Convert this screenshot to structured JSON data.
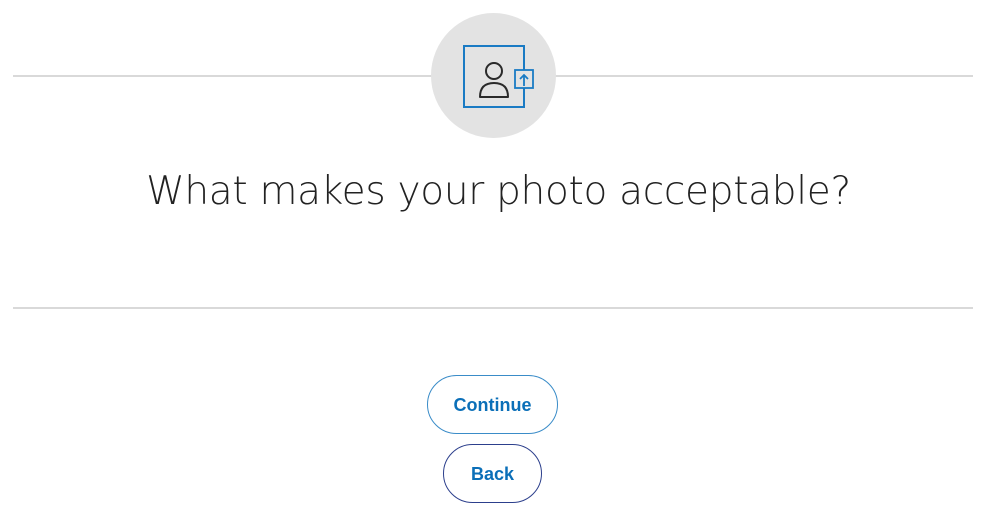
{
  "header": {
    "icon": "user-photo-upload-icon"
  },
  "main": {
    "heading": "What makes your photo acceptable?"
  },
  "actions": {
    "continue_label": "Continue",
    "back_label": "Back"
  },
  "colors": {
    "accent": "#0b6fb8",
    "back_border": "#2c3f8c",
    "divider": "#d9d9d9",
    "icon_circle": "#e3e3e3"
  }
}
